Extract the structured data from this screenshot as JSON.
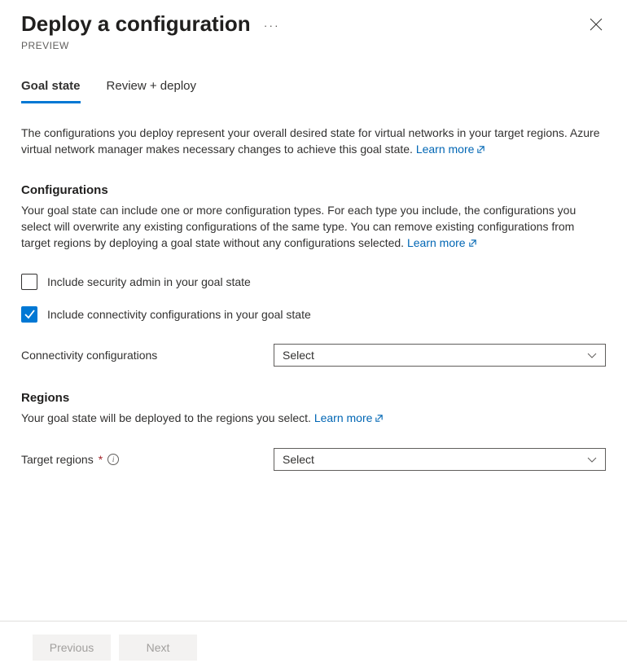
{
  "header": {
    "title": "Deploy a configuration",
    "badge": "PREVIEW"
  },
  "tabs": [
    {
      "label": "Goal state",
      "active": true
    },
    {
      "label": "Review + deploy",
      "active": false
    }
  ],
  "intro": {
    "text": "The configurations you deploy represent your overall desired state for virtual networks in your target regions. Azure virtual network manager makes necessary changes to achieve this goal state.",
    "link": "Learn more"
  },
  "configurations": {
    "title": "Configurations",
    "desc": "Your goal state can include one or more configuration types. For each type you include, the configurations you select will overwrite any existing configurations of the same type. You can remove existing configurations from target regions by deploying a goal state without any configurations selected.",
    "link": "Learn more",
    "checkboxes": {
      "security": {
        "label": "Include security admin in your goal state",
        "checked": false
      },
      "connectivity": {
        "label": "Include connectivity configurations in your goal state",
        "checked": true
      }
    },
    "connectivity_field": {
      "label": "Connectivity configurations",
      "placeholder": "Select"
    }
  },
  "regions": {
    "title": "Regions",
    "desc": "Your goal state will be deployed to the regions you select.",
    "link": "Learn more",
    "target_field": {
      "label": "Target regions",
      "required": true,
      "placeholder": "Select"
    }
  },
  "footer": {
    "previous": "Previous",
    "next": "Next"
  }
}
